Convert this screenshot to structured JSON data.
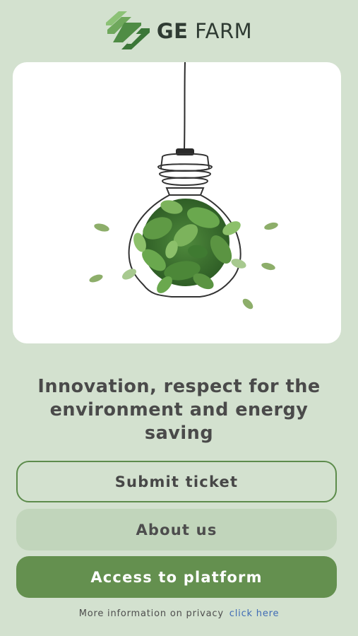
{
  "brand": {
    "logo_icon": "ge-farm-logo-icon",
    "name_bold": "GE",
    "name_regular": " FARM",
    "colors": {
      "logo_light": "#7fb96a",
      "logo_dark": "#3d7a3a"
    }
  },
  "hero": {
    "image": "lightbulb-with-green-leaves-illustration"
  },
  "tagline": "Innovation, respect for the environment and energy saving",
  "buttons": {
    "submit_ticket": "Submit ticket",
    "about_us": "About us",
    "access_platform": "Access to platform"
  },
  "privacy": {
    "text": "More information on privacy",
    "link": "click here"
  },
  "colors": {
    "background": "#d3e1cf",
    "accent": "#64904f",
    "outline": "#5d8c4c",
    "secondary_button": "#c1d5bb",
    "link": "#3f6bb5"
  }
}
